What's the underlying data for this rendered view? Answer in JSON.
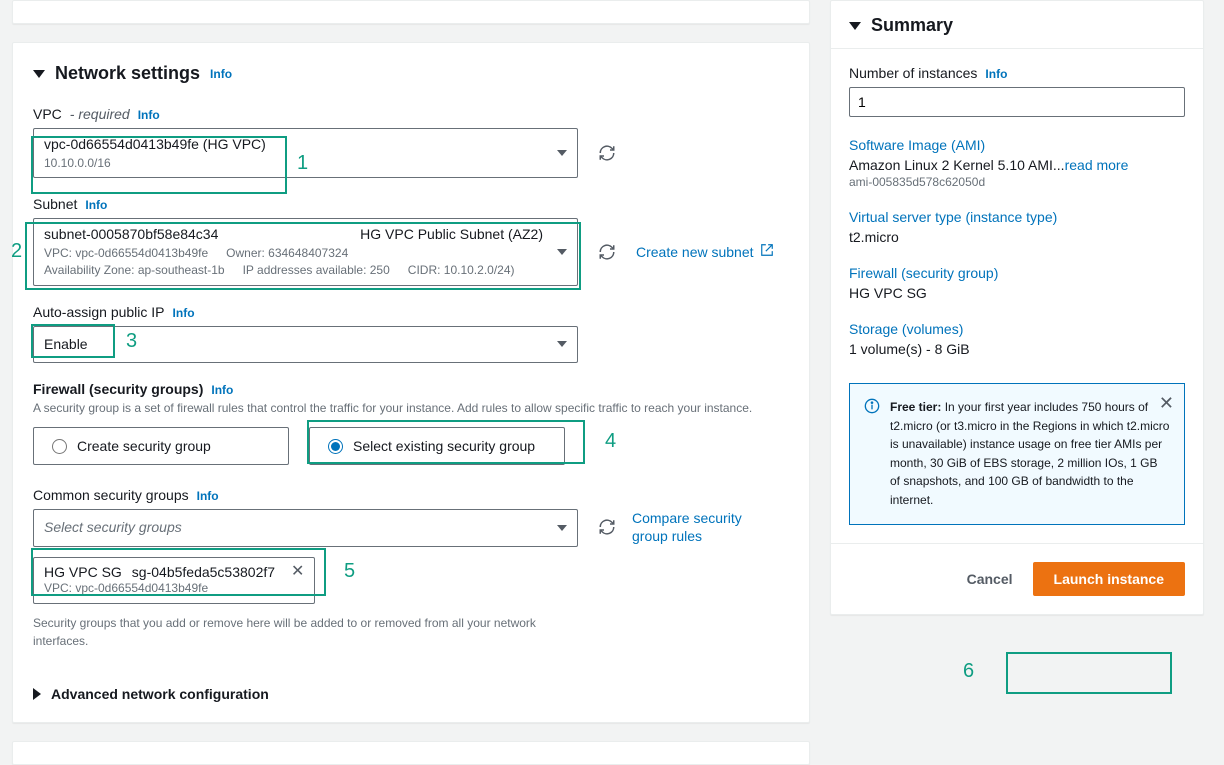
{
  "network": {
    "title": "Network settings",
    "info": "Info",
    "vpc": {
      "label": "VPC",
      "required": "- required",
      "info": "Info",
      "value": "vpc-0d66554d0413b49fe (HG VPC)",
      "cidr": "10.10.0.0/16"
    },
    "subnet": {
      "label": "Subnet",
      "info": "Info",
      "id": "subnet-0005870bf58e84c34",
      "name": "HG VPC Public Subnet (AZ2)",
      "vpc": "VPC: vpc-0d66554d0413b49fe",
      "owner": "Owner: 634648407324",
      "az": "Availability Zone: ap-southeast-1b",
      "avail": "IP addresses available: 250",
      "cidr": "CIDR: 10.10.2.0/24)",
      "create_link": "Create new subnet"
    },
    "autoip": {
      "label": "Auto-assign public IP",
      "info": "Info",
      "value": "Enable"
    },
    "firewall": {
      "label": "Firewall (security groups)",
      "info": "Info",
      "help": "A security group is a set of firewall rules that control the traffic for your instance. Add rules to allow specific traffic to reach your instance.",
      "create_opt": "Create security group",
      "select_opt": "Select existing security group"
    },
    "common_sg": {
      "label": "Common security groups",
      "info": "Info",
      "placeholder": "Select security groups",
      "compare": "Compare security group rules",
      "token_name": "HG VPC SG",
      "token_id": "sg-04b5feda5c53802f7",
      "token_vpc": "VPC: vpc-0d66554d0413b49fe",
      "note": "Security groups that you add or remove here will be added to or removed from all your network interfaces."
    },
    "advanced": "Advanced network configuration"
  },
  "summary": {
    "title": "Summary",
    "num_label": "Number of instances",
    "info": "Info",
    "num_value": "1",
    "ami_h": "Software Image (AMI)",
    "ami_val": "Amazon Linux 2 Kernel 5.10 AMI...",
    "read_more": "read more",
    "ami_id": "ami-005835d578c62050d",
    "type_h": "Virtual server type (instance type)",
    "type_val": "t2.micro",
    "fw_h": "Firewall (security group)",
    "fw_val": "HG VPC SG",
    "storage_h": "Storage (volumes)",
    "storage_val": "1 volume(s) - 8 GiB",
    "free_tier_label": "Free tier:",
    "free_tier_text": " In your first year includes 750 hours of t2.micro (or t3.micro in the Regions in which t2.micro is unavailable) instance usage on free tier AMIs per month, 30 GiB of EBS storage, 2 million IOs, 1 GB of snapshots, and 100 GB of bandwidth to the internet.",
    "cancel": "Cancel",
    "launch": "Launch instance"
  },
  "annotations": {
    "n1": "1",
    "n2": "2",
    "n3": "3",
    "n4": "4",
    "n5": "5",
    "n6": "6"
  }
}
